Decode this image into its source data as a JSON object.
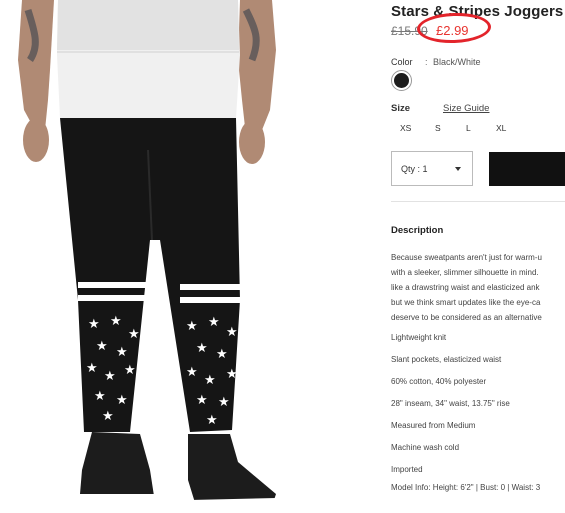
{
  "product": {
    "title": "Stars & Stripes Joggers",
    "original_price": "£15.90",
    "sale_price": "£2.99",
    "color_label": "Color",
    "color_separator": ":",
    "color_value": "Black/White",
    "size_label": "Size",
    "size_guide_label": "Size Guide",
    "sizes": [
      "XS",
      "S",
      "L",
      "XL"
    ],
    "quantity_label": "Qty : 1",
    "description_title": "Description",
    "description_lines": [
      "Because sweatpants aren't just for warm-u",
      "with a sleeker, slimmer silhouette in mind.",
      "like a drawstring waist and elasticized ank",
      "but we think smart updates like the eye-ca",
      "deserve to be considered as an alternative"
    ],
    "details": [
      "Lightweight knit",
      "Slant pockets, elasticized waist",
      "60% cotton, 40% polyester",
      "28\" inseam, 34\" waist, 13.75\" rise",
      "Measured from Medium",
      "Machine wash cold",
      "Imported",
      "Model Info: Height: 6'2\" | Bust: 0 | Waist: 3"
    ]
  },
  "colors": {
    "sale_red": "#e8332f",
    "circle_annotation": "#e3242b",
    "button_black": "#111111"
  },
  "icons": {
    "swatch": "black-color-swatch",
    "dropdown": "caret-down-icon"
  }
}
